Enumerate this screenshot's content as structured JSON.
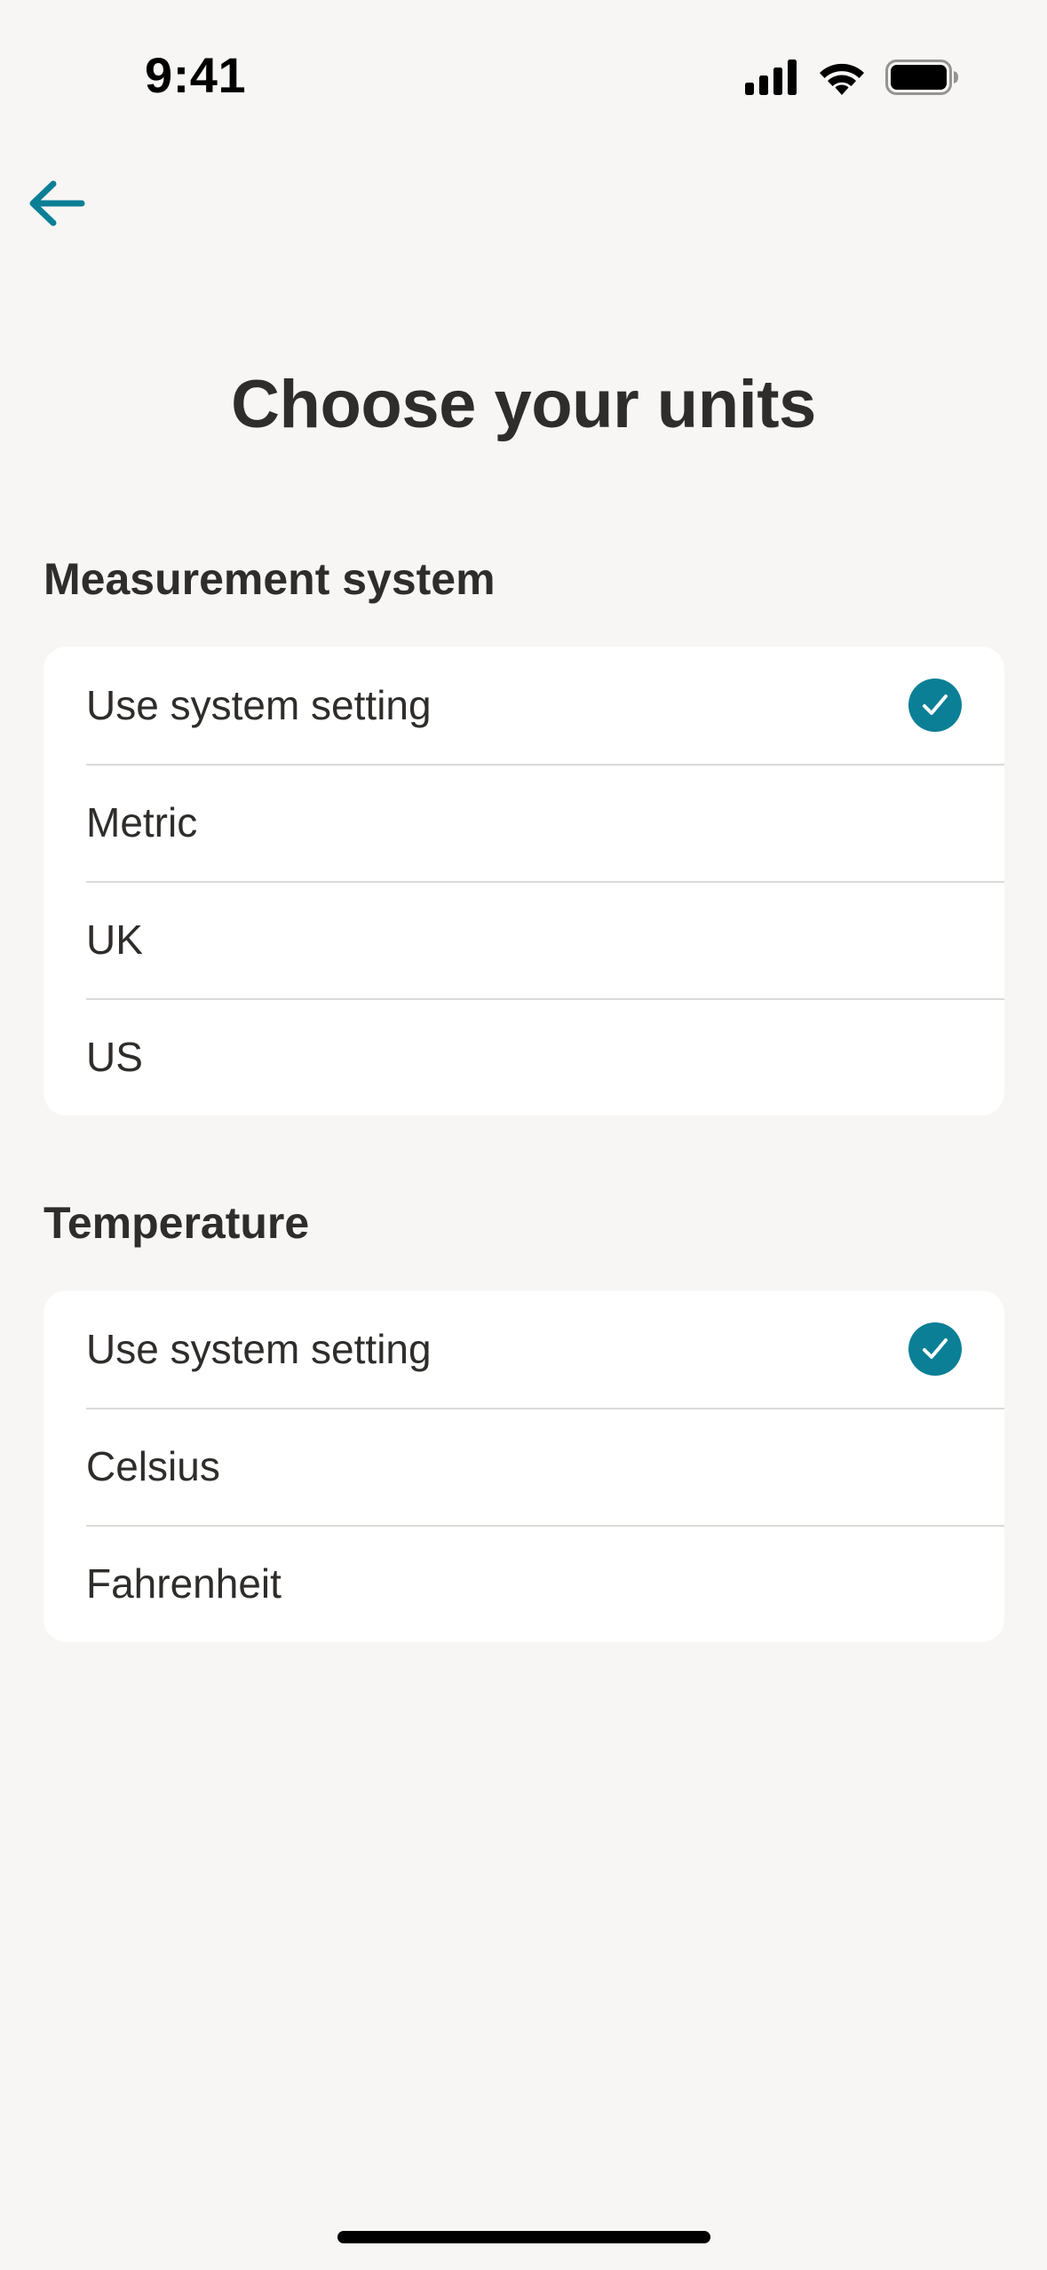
{
  "status_bar": {
    "time": "9:41",
    "icons": [
      "cellular-signal-icon",
      "wifi-icon",
      "battery-icon"
    ]
  },
  "nav": {
    "back_icon": "arrow-left-icon"
  },
  "title": "Choose your units",
  "measurement": {
    "heading": "Measurement system",
    "options": [
      {
        "label": "Use system setting",
        "selected": true
      },
      {
        "label": "Metric",
        "selected": false
      },
      {
        "label": "UK",
        "selected": false
      },
      {
        "label": "US",
        "selected": false
      }
    ]
  },
  "temperature": {
    "heading": "Temperature",
    "options": [
      {
        "label": "Use system setting",
        "selected": true
      },
      {
        "label": "Celsius",
        "selected": false
      },
      {
        "label": "Fahrenheit",
        "selected": false
      }
    ]
  },
  "colors": {
    "accent": "#0b7f96",
    "background": "#f7f6f4",
    "card": "#ffffff",
    "text": "#2f2d2b"
  }
}
